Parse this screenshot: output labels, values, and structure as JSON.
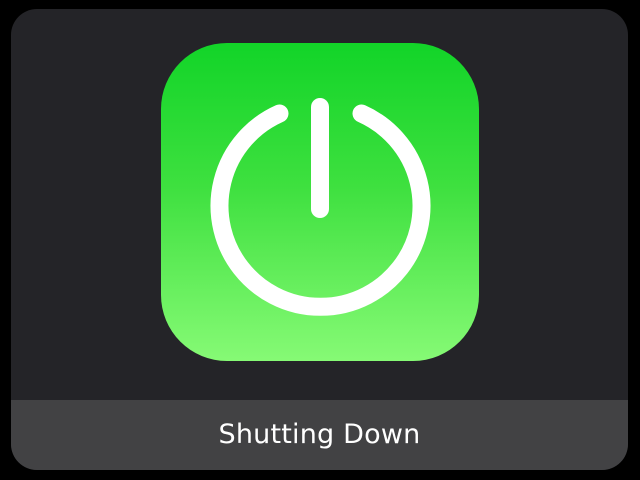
{
  "dialog": {
    "icon": "power-icon",
    "icon_color": "#ffffff",
    "tile_gradient": [
      "#12d428",
      "#86fa75"
    ],
    "status_text": "Shutting Down"
  }
}
